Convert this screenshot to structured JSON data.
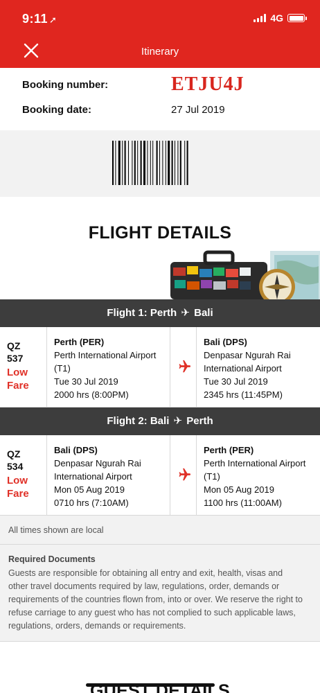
{
  "status_bar": {
    "time": "9:11",
    "network": "4G"
  },
  "header": {
    "title": "Itinerary"
  },
  "booking": {
    "number_label": "Booking number:",
    "number_value": "ETJU4J",
    "date_label": "Booking date:",
    "date_value": "27 Jul 2019"
  },
  "flight_details_title": "FLIGHT DETAILS",
  "flights": [
    {
      "bar_prefix": "Flight 1: Perth",
      "bar_suffix": "Bali",
      "flight_code": "QZ 537",
      "fare_line1": "Low",
      "fare_line2": "Fare",
      "departure": {
        "code": "Perth (PER)",
        "airport_line1": "Perth International Airport",
        "airport_line2": "(T1)",
        "date": "Tue 30 Jul 2019",
        "time": "2000 hrs (8:00PM)"
      },
      "arrival": {
        "code": "Bali (DPS)",
        "airport_line1": "Denpasar Ngurah Rai",
        "airport_line2": "International Airport",
        "date": "Tue 30 Jul 2019",
        "time": "2345 hrs (11:45PM)"
      }
    },
    {
      "bar_prefix": "Flight 2: Bali",
      "bar_suffix": "Perth",
      "flight_code": "QZ 534",
      "fare_line1": "Low",
      "fare_line2": "Fare",
      "departure": {
        "code": "Bali (DPS)",
        "airport_line1": "Denpasar Ngurah Rai",
        "airport_line2": "International Airport",
        "date": "Mon 05 Aug 2019",
        "time": "0710 hrs (7:10AM)"
      },
      "arrival": {
        "code": "Perth (PER)",
        "airport_line1": "Perth International Airport",
        "airport_line2": "(T1)",
        "date": "Mon 05 Aug 2019",
        "time": "1100 hrs (11:00AM)"
      }
    }
  ],
  "times_note": "All times shown are local",
  "required_documents": {
    "title": "Required Documents",
    "text": "Guests are responsible for obtaining all entry and exit, health, visas and other travel documents required by law, regulations, order, demands or requirements of the countries flown from, into or over. We reserve the right to refuse carriage to any guest who has not complied to such applicable laws, regulations, orders, demands or requirements."
  },
  "guest_details_title": "GUEST DETAILS",
  "colors": {
    "brand_red": "#e0261f",
    "booking_red": "#d8261e",
    "dark_bar": "#3d3d3d",
    "panel_grey": "#f2f2f2"
  }
}
